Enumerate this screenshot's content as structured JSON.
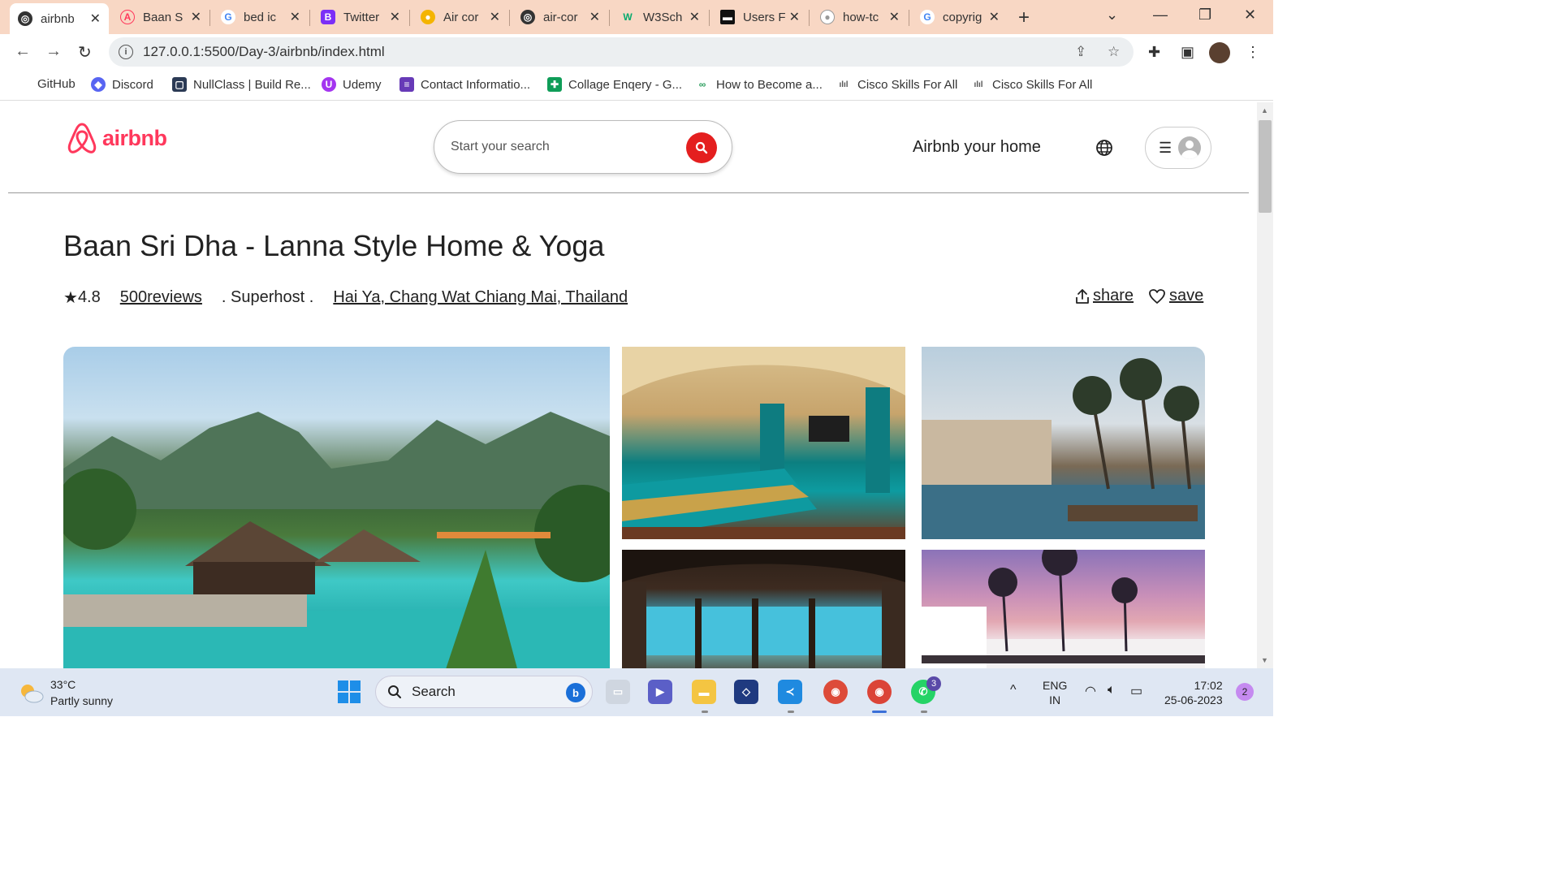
{
  "browser": {
    "tabs": [
      {
        "label": "airbnb",
        "icon": "globe-icon",
        "active": true
      },
      {
        "label": "Baan S",
        "icon": "airbnb-icon"
      },
      {
        "label": "bed ic",
        "icon": "google-icon"
      },
      {
        "label": "Twitter",
        "icon": "bootstrap-icon"
      },
      {
        "label": "Air cor",
        "icon": "map-pin-icon"
      },
      {
        "label": "air-cor",
        "icon": "globe-icon"
      },
      {
        "label": "W3Sch",
        "icon": "w3schools-icon"
      },
      {
        "label": "Users F",
        "icon": "unsplash-icon"
      },
      {
        "label": "how-tc",
        "icon": "github-icon"
      },
      {
        "label": "copyrig",
        "icon": "google-icon"
      }
    ],
    "url": "127.0.0.1:5500/Day-3/airbnb/index.html",
    "bookmarks": [
      {
        "label": "GitHub",
        "icon": "github-icon"
      },
      {
        "label": "Discord",
        "icon": "discord-icon"
      },
      {
        "label": "NullClass | Build Re...",
        "icon": "nullclass-icon"
      },
      {
        "label": "Udemy",
        "icon": "udemy-icon"
      },
      {
        "label": "Contact Informatio...",
        "icon": "forms-icon"
      },
      {
        "label": "Collage Enqery - G...",
        "icon": "sheets-icon"
      },
      {
        "label": "How to Become a...",
        "icon": "link-icon"
      },
      {
        "label": "Cisco Skills For All",
        "icon": "cisco-icon"
      },
      {
        "label": "Cisco Skills For All",
        "icon": "cisco-icon"
      }
    ]
  },
  "site": {
    "logo_text": "airbnb",
    "search_placeholder": "Start your search",
    "host_link": "Airbnb your home"
  },
  "listing": {
    "title": "Baan Sri Dha - Lanna Style Home & Yoga",
    "rating": "4.8",
    "reviews": "500reviews",
    "superhost": ". Superhost .",
    "location": "Hai Ya, Chang Wat Chiang Mai, Thailand",
    "share_label": "share",
    "save_label": "save",
    "photos": [
      "pool-resort-photo",
      "bedroom-photo",
      "palm-pool-photo",
      "beach-view-room-photo",
      "sunset-villa-photo"
    ]
  },
  "taskbar": {
    "temperature": "33°C",
    "weather": "Partly sunny",
    "search_label": "Search",
    "whatsapp_badge": "3",
    "lang": "ENG",
    "region": "IN",
    "time": "17:02",
    "date": "25-06-2023",
    "notification_count": "2"
  },
  "colors": {
    "brand": "#ff385c",
    "search_button": "#e41f1f",
    "tabbar": "#f8d7c4",
    "taskbar": "#dfe7f3"
  }
}
